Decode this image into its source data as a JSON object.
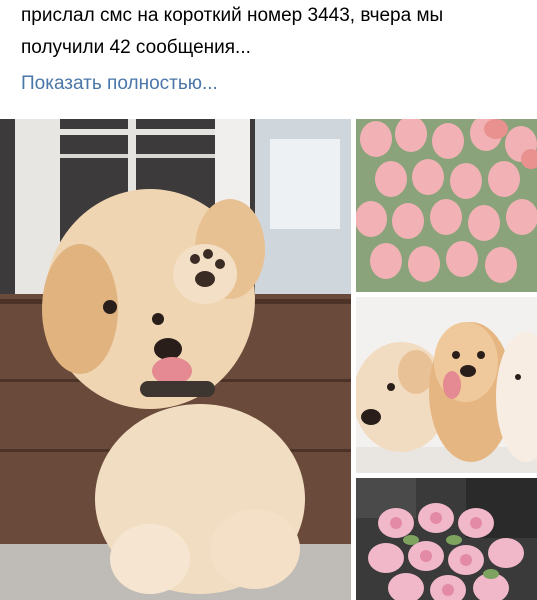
{
  "post": {
    "line_partial": "прислал смс на короткий номер 3443, вчера мы",
    "line_2": "получили 42 сообщения...",
    "show_more_label": "Показать полностью..."
  },
  "gallery": {
    "photos": [
      {
        "subject": "puppy",
        "description_visible": false
      },
      {
        "subject": "pink-tulips"
      },
      {
        "subject": "puppies"
      },
      {
        "subject": "pink-peonies"
      }
    ]
  },
  "colors": {
    "link": "#4a76a8",
    "text": "#000000"
  }
}
